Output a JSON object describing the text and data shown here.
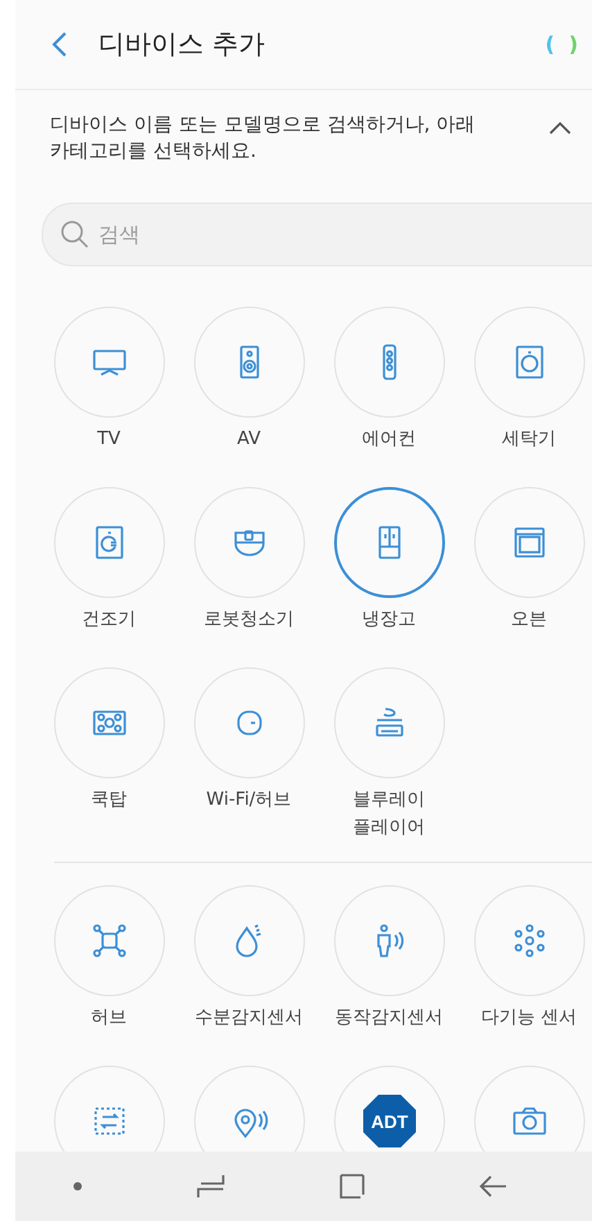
{
  "header": {
    "title": "디바이스 추가",
    "status_marks": [
      {
        "text": "(",
        "color": "#4fc3e8"
      },
      {
        "text": ")",
        "color": "#6fd36a"
      }
    ]
  },
  "description": {
    "text": "디바이스 이름 또는 모델명으로 검색하거나, 아래 카테고리를 선택하세요.",
    "expanded": true
  },
  "search": {
    "placeholder": "검색"
  },
  "groups": [
    {
      "items": [
        {
          "label": "TV",
          "selected": false
        },
        {
          "label": "AV",
          "selected": false
        },
        {
          "label": "에어컨",
          "selected": false
        },
        {
          "label": "세탁기",
          "selected": false
        },
        {
          "label": "건조기",
          "selected": false
        },
        {
          "label": "로봇청소기",
          "selected": false
        },
        {
          "label": "냉장고",
          "selected": true
        },
        {
          "label": "오븐",
          "selected": false
        },
        {
          "label": "쿡탑",
          "selected": false
        },
        {
          "label": "Wi-Fi/허브",
          "selected": false
        },
        {
          "label": "블루레이\n플레이어",
          "selected": false
        }
      ]
    },
    {
      "items": [
        {
          "label": "허브",
          "selected": false
        },
        {
          "label": "수분감지센서",
          "selected": false
        },
        {
          "label": "동작감지센서",
          "selected": false
        },
        {
          "label": "다기능 센서",
          "selected": false
        },
        {
          "selected": false
        },
        {
          "selected": false
        },
        {
          "selected": false,
          "logo_text": "ADT"
        },
        {
          "selected": false
        }
      ]
    }
  ]
}
